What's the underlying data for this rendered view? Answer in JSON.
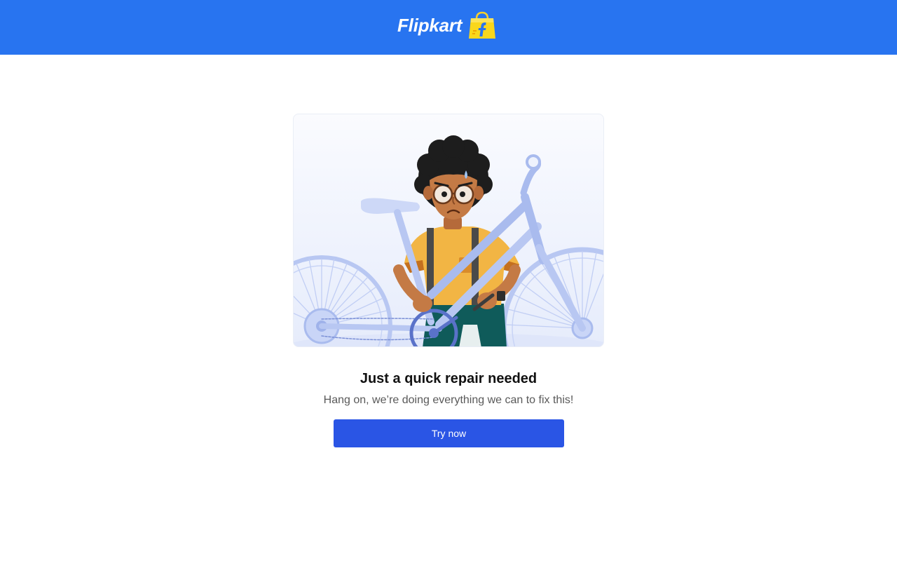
{
  "header": {
    "brand_name": "Flipkart",
    "brand_icon": "flipkart-bag-icon",
    "background_color": "#2874f0"
  },
  "illustration": {
    "name": "person-repairing-bicycle-illustration"
  },
  "message": {
    "title": "Just a quick repair needed",
    "subtitle": "Hang on, we’re doing everything we can to fix this!"
  },
  "action": {
    "button_label": "Try now",
    "button_color": "#2a55e5"
  }
}
